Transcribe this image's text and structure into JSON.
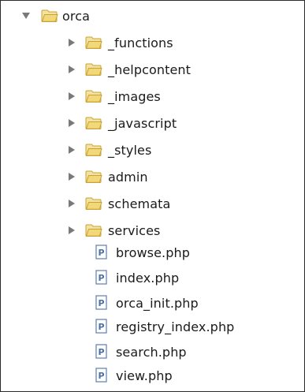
{
  "tree": {
    "root": {
      "label": "orca",
      "expanded": true,
      "type": "folder"
    },
    "folders": [
      {
        "label": "_functions"
      },
      {
        "label": "_helpcontent"
      },
      {
        "label": "_images"
      },
      {
        "label": "_javascript"
      },
      {
        "label": "_styles"
      },
      {
        "label": "admin"
      },
      {
        "label": "schemata"
      },
      {
        "label": "services"
      }
    ],
    "files": [
      {
        "label": "browse.php"
      },
      {
        "label": "index.php"
      },
      {
        "label": "orca_init.php"
      },
      {
        "label": "registry_index.php"
      },
      {
        "label": "search.php"
      },
      {
        "label": "view.php"
      }
    ],
    "colors": {
      "folder_fill": "#f1d87a",
      "folder_stroke": "#c9a233",
      "php_icon_border": "#5b7fb6",
      "php_icon_text": "#4d6fa6",
      "arrow": "#7a7a7a"
    },
    "icons": {
      "folder": "folder-icon",
      "php_file": "php-file-icon",
      "expanded": "triangle-down-icon",
      "collapsed": "triangle-right-icon"
    }
  }
}
